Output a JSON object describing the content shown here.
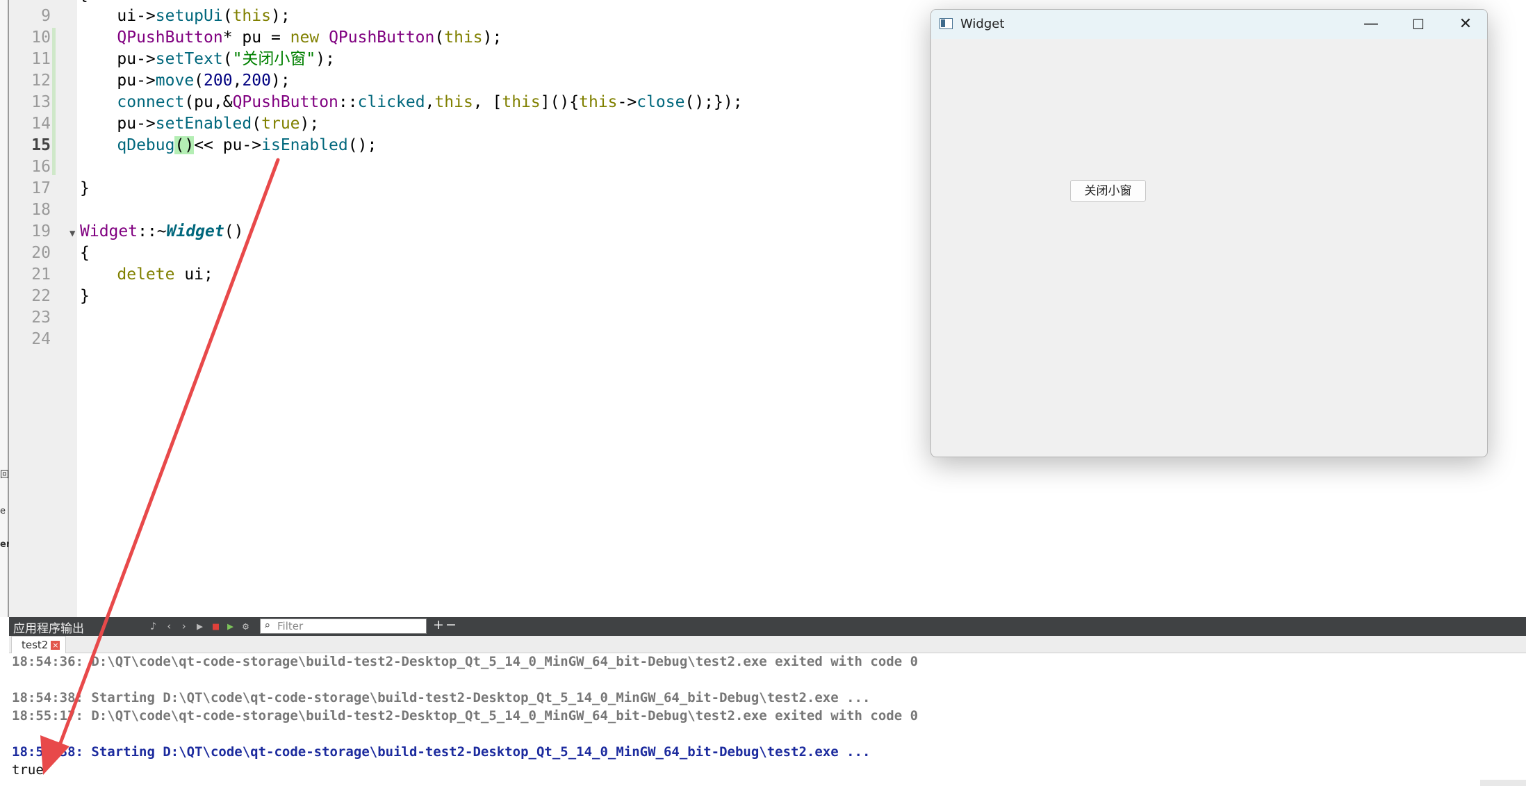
{
  "editor": {
    "line_numbers": [
      "9",
      "10",
      "11",
      "12",
      "13",
      "14",
      "15",
      "16",
      "17",
      "18",
      "19",
      "20",
      "21",
      "22",
      "23",
      "24"
    ],
    "current_line": "15",
    "code": {
      "l9": {
        "a": "    ui->",
        "b": "setupUi",
        "c": "(",
        "d": "this",
        "e": ");"
      },
      "l10": {
        "a": "    ",
        "b": "QPushButton",
        "c": "* pu = ",
        "d": "new",
        "e": " ",
        "f": "QPushButton",
        "g": "(",
        "h": "this",
        "i": ");"
      },
      "l11": {
        "a": "    pu->",
        "b": "setText",
        "c": "(",
        "d": "\"关闭小窗\"",
        "e": ");"
      },
      "l12": {
        "a": "    pu->",
        "b": "move",
        "c": "(",
        "d": "200",
        "e": ",",
        "f": "200",
        "g": ");"
      },
      "l13": {
        "a": "    ",
        "b": "connect",
        "c": "(pu,&",
        "d": "QPushButton",
        "e": "::",
        "f": "clicked",
        "g": ",",
        "h": "this",
        "i": ", [",
        "j": "this",
        "k": "](){",
        "l": "this",
        "m": "->",
        "n": "close",
        "o": "();});"
      },
      "l14": {
        "a": "    pu->",
        "b": "setEnabled",
        "c": "(",
        "d": "true",
        "e": ");"
      },
      "l15": {
        "a": "    ",
        "b": "qDebug",
        "c": "()",
        "d": "<< pu->",
        "e": "isEnabled",
        "f": "();"
      },
      "l17": "}",
      "l19": {
        "a": "Widget",
        "b": "::~",
        "c": "Widget",
        "d": "()"
      },
      "l20": "{",
      "l21": {
        "a": "    ",
        "b": "delete",
        "c": " ui;"
      },
      "l22": "}"
    },
    "top_partial": "{"
  },
  "widget_window": {
    "title": "Widget",
    "minimize_glyph": "—",
    "maximize_glyph": "☐",
    "close_glyph": "✕",
    "button_label": "关闭小窗"
  },
  "output_pane": {
    "title": "应用程序输出",
    "filter_placeholder": "Filter",
    "plus": "+",
    "minus": "−",
    "tab_label": "test2",
    "tab_close": "×",
    "lines": [
      "18:54:36: D:\\QT\\code\\qt-code-storage\\build-test2-Desktop_Qt_5_14_0_MinGW_64_bit-Debug\\test2.exe exited with code 0",
      "18:54:38: Starting D:\\QT\\code\\qt-code-storage\\build-test2-Desktop_Qt_5_14_0_MinGW_64_bit-Debug\\test2.exe ...",
      "18:55:17: D:\\QT\\code\\qt-code-storage\\build-test2-Desktop_Qt_5_14_0_MinGW_64_bit-Debug\\test2.exe exited with code 0",
      "18:55:38: Starting D:\\QT\\code\\qt-code-storage\\build-test2-Desktop_Qt_5_14_0_MinGW_64_bit-Debug\\test2.exe ...",
      "true"
    ]
  },
  "left_stubs": [
    "回",
    "e",
    "er"
  ],
  "colors": {
    "arrow": "#e8494a",
    "keyword": "#808000",
    "class": "#800080",
    "function": "#00677c",
    "string": "#008000",
    "active_output": "#1c2b9e"
  }
}
